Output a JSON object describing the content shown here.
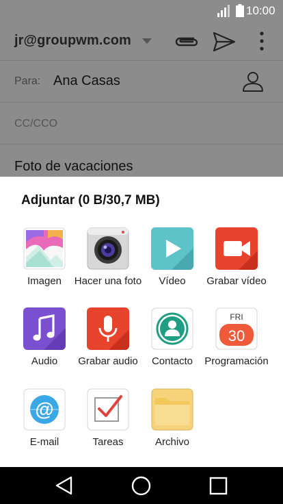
{
  "status": {
    "time": "10:00"
  },
  "compose": {
    "account": "jr@groupwm.com",
    "to_label": "Para:",
    "to_value": "Ana Casas",
    "cc_label": "CC/CCO",
    "subject": "Foto de vacaciones"
  },
  "sheet": {
    "title": "Adjuntar (0 B/30,7 MB)",
    "items": [
      {
        "label": "Imagen",
        "icon": "gallery-icon"
      },
      {
        "label": "Hacer una foto",
        "icon": "camera-icon"
      },
      {
        "label": "Vídeo",
        "icon": "video-play-icon"
      },
      {
        "label": "Grabar vídeo",
        "icon": "video-record-icon"
      },
      {
        "label": "Audio",
        "icon": "music-icon"
      },
      {
        "label": "Grabar audio",
        "icon": "microphone-icon"
      },
      {
        "label": "Contacto",
        "icon": "contact-icon"
      },
      {
        "label": "Programación",
        "icon": "calendar-icon",
        "day": "FRI",
        "date": "30"
      },
      {
        "label": "E-mail",
        "icon": "at-sign-icon"
      },
      {
        "label": "Tareas",
        "icon": "task-check-icon"
      },
      {
        "label": "Archivo",
        "icon": "folder-icon"
      }
    ]
  },
  "colors": {
    "dim_overlay": "#8c8c8c",
    "video_play": "#5ec3c9",
    "video_record": "#e8432d",
    "audio": "#7a4fd0",
    "record_audio": "#e8432d",
    "contact": "#1f9e84",
    "calendar_red": "#ef5a3a",
    "email_blue": "#3aa7e6",
    "folder": "#f6d37a"
  }
}
